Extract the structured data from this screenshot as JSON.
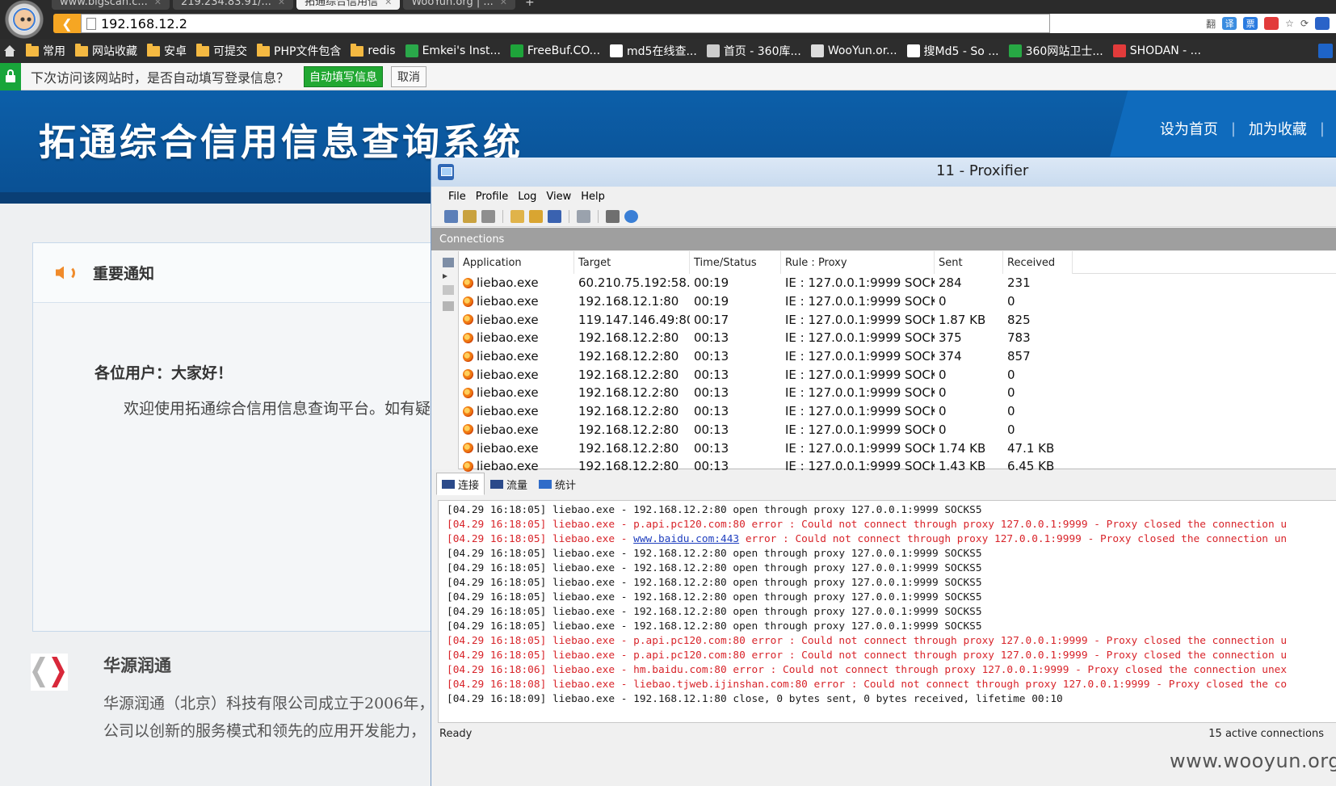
{
  "browser": {
    "tabs": [
      {
        "label": "www.bigscan.c...",
        "active": false
      },
      {
        "label": "219.234.83.91/...",
        "active": false
      },
      {
        "label": "拓通综合信用信",
        "active": true
      },
      {
        "label": "WooYun.org | ...",
        "active": false
      }
    ],
    "new_tab": "+",
    "address": "192.168.12.2",
    "tool_glyphs": [
      "翻",
      "译",
      "票",
      "☆",
      "⟳"
    ]
  },
  "bookmarks": [
    {
      "label": "常用",
      "icon": "folder-icon"
    },
    {
      "label": "网站收藏",
      "icon": "folder-icon"
    },
    {
      "label": "安卓",
      "icon": "folder-icon"
    },
    {
      "label": "可提交",
      "icon": "folder-icon"
    },
    {
      "label": "PHP文件包含",
      "icon": "folder-icon"
    },
    {
      "label": "redis",
      "icon": "folder-icon"
    },
    {
      "label": "Emkei's Inst...",
      "icon": "leaf-icon",
      "color": "#2aa84a"
    },
    {
      "label": "FreeBuf.CO...",
      "icon": "f-icon",
      "color": "#1ea43a"
    },
    {
      "label": "md5在线查...",
      "icon": "grid-icon",
      "color": "#ffffff"
    },
    {
      "label": "首页 - 360库...",
      "icon": "star-icon",
      "color": "#cccccc"
    },
    {
      "label": "WooYun.or...",
      "icon": "cloud-icon",
      "color": "#dddddd"
    },
    {
      "label": "搜Md5 - So ...",
      "icon": "page-icon",
      "color": "#ffffff"
    },
    {
      "label": "360网站卫士...",
      "icon": "shield-icon",
      "color": "#27a844"
    },
    {
      "label": "SHODAN - ...",
      "icon": "flower-icon",
      "color": "#e23b3b"
    }
  ],
  "autofill": {
    "prompt": "下次访问该网站时，是否自动填写登录信息？",
    "fill_button": "自动填写信息",
    "cancel_button": "取消"
  },
  "site": {
    "title": "拓通综合信用信息查询系统",
    "link_home": "设为首页",
    "link_sep": "|",
    "link_fav": "加为收藏",
    "link_more": "|",
    "notice_title": "重要通知",
    "greeting": "各位用户：大家好！",
    "welcome": "欢迎使用拓通综合信用信息查询平台。如有疑",
    "company_name": "华源润通",
    "company_text_1": "华源润通（北京）科技有限公司成立于2006年，",
    "company_text_2": "公司以创新的服务模式和领先的应用开发能力，"
  },
  "proxifier": {
    "title": "11 - Proxifier",
    "menu": [
      "File",
      "Profile",
      "Log",
      "View",
      "Help"
    ],
    "connections_label": "Connections",
    "columns": [
      "Application",
      "Target",
      "Time/Status",
      "Rule : Proxy",
      "Sent",
      "Received"
    ],
    "rows": [
      {
        "app": "liebao.exe",
        "target": "60.210.75.192:58...",
        "time": "00:19",
        "rule": "IE : 127.0.0.1:9999 SOCK...",
        "sent": "284",
        "recv": "231"
      },
      {
        "app": "liebao.exe",
        "target": "192.168.12.1:80",
        "time": "00:19",
        "rule": "IE : 127.0.0.1:9999 SOCK...",
        "sent": "0",
        "recv": "0"
      },
      {
        "app": "liebao.exe",
        "target": "119.147.146.49:80",
        "time": "00:17",
        "rule": "IE : 127.0.0.1:9999 SOCK...",
        "sent": "1.87 KB",
        "recv": "825"
      },
      {
        "app": "liebao.exe",
        "target": "192.168.12.2:80",
        "time": "00:13",
        "rule": "IE : 127.0.0.1:9999 SOCK...",
        "sent": "375",
        "recv": "783"
      },
      {
        "app": "liebao.exe",
        "target": "192.168.12.2:80",
        "time": "00:13",
        "rule": "IE : 127.0.0.1:9999 SOCK...",
        "sent": "374",
        "recv": "857"
      },
      {
        "app": "liebao.exe",
        "target": "192.168.12.2:80",
        "time": "00:13",
        "rule": "IE : 127.0.0.1:9999 SOCK...",
        "sent": "0",
        "recv": "0"
      },
      {
        "app": "liebao.exe",
        "target": "192.168.12.2:80",
        "time": "00:13",
        "rule": "IE : 127.0.0.1:9999 SOCK...",
        "sent": "0",
        "recv": "0"
      },
      {
        "app": "liebao.exe",
        "target": "192.168.12.2:80",
        "time": "00:13",
        "rule": "IE : 127.0.0.1:9999 SOCK...",
        "sent": "0",
        "recv": "0"
      },
      {
        "app": "liebao.exe",
        "target": "192.168.12.2:80",
        "time": "00:13",
        "rule": "IE : 127.0.0.1:9999 SOCK...",
        "sent": "0",
        "recv": "0"
      },
      {
        "app": "liebao.exe",
        "target": "192.168.12.2:80",
        "time": "00:13",
        "rule": "IE : 127.0.0.1:9999 SOCK...",
        "sent": "1.74 KB",
        "recv": "47.1 KB"
      },
      {
        "app": "liebao.exe",
        "target": "192.168.12.2:80",
        "time": "00:13",
        "rule": "IE : 127.0.0.1:9999 SOCK...",
        "sent": "1.43 KB",
        "recv": "6.45 KB"
      }
    ],
    "bottom_tabs": [
      {
        "label": "连接",
        "icon": "connections-tab-icon",
        "active": true
      },
      {
        "label": "流量",
        "icon": "traffic-tab-icon",
        "active": false
      },
      {
        "label": "统计",
        "icon": "statistics-tab-icon",
        "active": false
      }
    ],
    "log": [
      {
        "text": "[04.29 16:18:05] liebao.exe - 192.168.12.2:80 open through proxy 127.0.0.1:9999 SOCKS5",
        "error": false
      },
      {
        "text": "[04.29 16:18:05] liebao.exe - p.api.pc120.com:80 error : Could not connect through proxy 127.0.0.1:9999 - Proxy closed the connection u",
        "error": true
      },
      {
        "pre": "[04.29 16:18:05] liebao.exe - ",
        "link": "www.baidu.com:443",
        "post": " error : Could not connect through proxy 127.0.0.1:9999 - Proxy closed the connection un",
        "error": true
      },
      {
        "text": "[04.29 16:18:05] liebao.exe - 192.168.12.2:80 open through proxy 127.0.0.1:9999 SOCKS5",
        "error": false
      },
      {
        "text": "[04.29 16:18:05] liebao.exe - 192.168.12.2:80 open through proxy 127.0.0.1:9999 SOCKS5",
        "error": false
      },
      {
        "text": "[04.29 16:18:05] liebao.exe - 192.168.12.2:80 open through proxy 127.0.0.1:9999 SOCKS5",
        "error": false
      },
      {
        "text": "[04.29 16:18:05] liebao.exe - 192.168.12.2:80 open through proxy 127.0.0.1:9999 SOCKS5",
        "error": false
      },
      {
        "text": "[04.29 16:18:05] liebao.exe - 192.168.12.2:80 open through proxy 127.0.0.1:9999 SOCKS5",
        "error": false
      },
      {
        "text": "[04.29 16:18:05] liebao.exe - 192.168.12.2:80 open through proxy 127.0.0.1:9999 SOCKS5",
        "error": false
      },
      {
        "text": "[04.29 16:18:05] liebao.exe - p.api.pc120.com:80 error : Could not connect through proxy 127.0.0.1:9999 - Proxy closed the connection u",
        "error": true
      },
      {
        "text": "[04.29 16:18:05] liebao.exe - p.api.pc120.com:80 error : Could not connect through proxy 127.0.0.1:9999 - Proxy closed the connection u",
        "error": true
      },
      {
        "text": "[04.29 16:18:06] liebao.exe - hm.baidu.com:80 error : Could not connect through proxy 127.0.0.1:9999 - Proxy closed the connection unex",
        "error": true
      },
      {
        "text": "[04.29 16:18:08] liebao.exe - liebao.tjweb.ijinshan.com:80 error : Could not connect through proxy 127.0.0.1:9999 - Proxy closed the co",
        "error": true
      },
      {
        "text": "[04.29 16:18:09] liebao.exe - 192.168.12.1:80 close, 0 bytes sent, 0 bytes received, lifetime 00:10",
        "error": false
      }
    ],
    "status_left": "Ready",
    "status_right": "15 active connections"
  },
  "watermark": "www.wooyun.org",
  "colors": {
    "error": "#d8242a",
    "banner": "#0c5fa9",
    "accent": "#f6a623"
  }
}
